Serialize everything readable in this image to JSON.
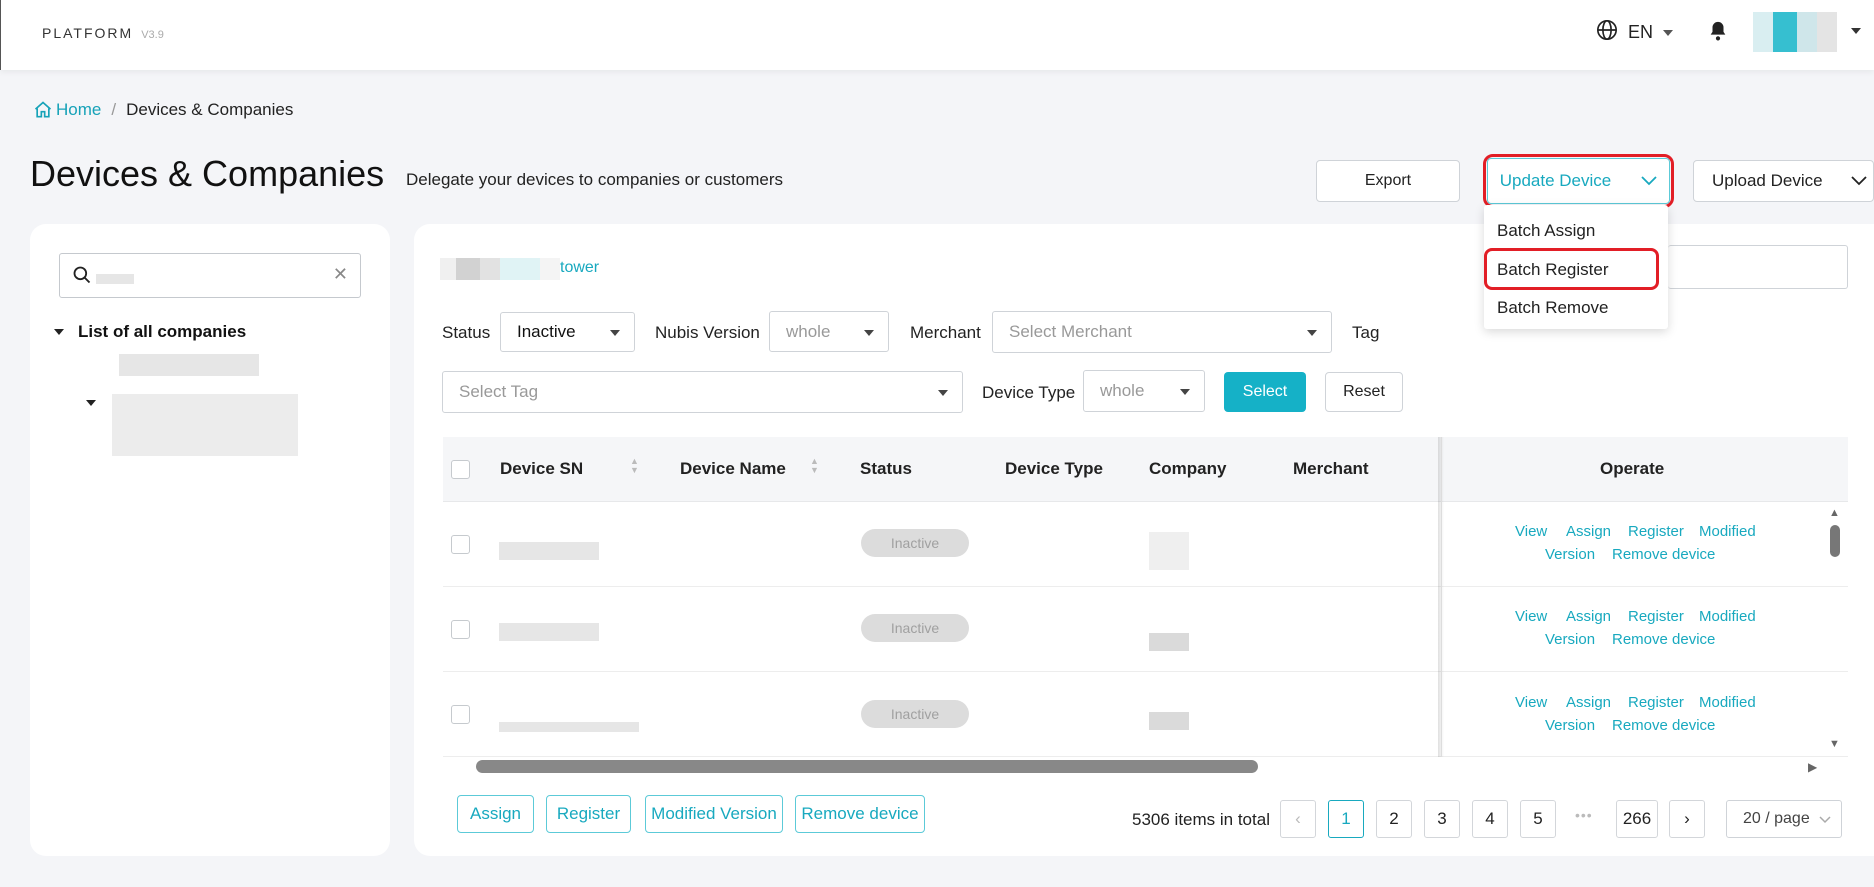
{
  "header": {
    "brand": "PLATFORM",
    "version": "V3.9",
    "language": "EN"
  },
  "breadcrumb": {
    "home": "Home",
    "current": "Devices & Companies"
  },
  "page": {
    "title": "Devices & Companies",
    "subtitle": "Delegate your devices to companies or customers"
  },
  "actions": {
    "export": "Export",
    "update_device": "Update Device",
    "upload_device": "Upload Device",
    "update_menu": [
      "Batch Assign",
      "Batch Register",
      "Batch Remove"
    ]
  },
  "sidebar": {
    "tree_root": "List of all companies"
  },
  "main": {
    "company_link": "tower",
    "filters": {
      "status_label": "Status",
      "status_value": "Inactive",
      "nubis_label": "Nubis Version",
      "nubis_value": "whole",
      "merchant_label": "Merchant",
      "merchant_placeholder": "Select Merchant",
      "tag_label": "Tag",
      "tag_placeholder": "Select Tag",
      "device_type_label": "Device Type",
      "device_type_value": "whole",
      "select_button": "Select",
      "reset_button": "Reset"
    },
    "table": {
      "columns": [
        "Device SN",
        "Device Name",
        "Status",
        "Device Type",
        "Company",
        "Merchant",
        "Operate"
      ],
      "rows": [
        {
          "status": "Inactive"
        },
        {
          "status": "Inactive"
        },
        {
          "status": "Inactive"
        }
      ],
      "row_actions": [
        "View",
        "Assign",
        "Register",
        "Modified",
        "Version",
        "Remove device"
      ]
    },
    "bulk_actions": [
      "Assign",
      "Register",
      "Modified Version",
      "Remove device"
    ],
    "pagination": {
      "total": "5306 items in total",
      "pages": [
        "1",
        "2",
        "3",
        "4",
        "5",
        "266"
      ],
      "ellipsis": "•••",
      "current": "1",
      "page_size": "20 / page"
    }
  },
  "colors": {
    "accent": "#18a9bf",
    "highlight_ring": "#e21e26"
  }
}
